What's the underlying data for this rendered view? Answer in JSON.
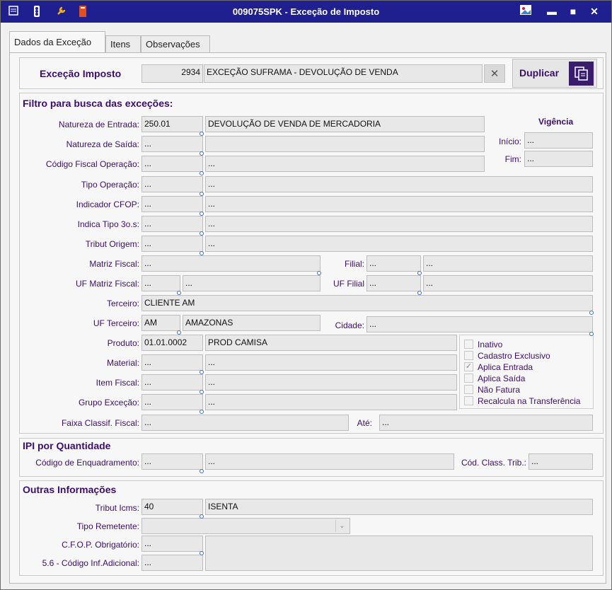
{
  "window": {
    "title": "009075SPK - Exceção de Imposto",
    "titlebar_color": "#1f1f8f",
    "toolbar_icons": [
      "menu-icon",
      "traffic-light-icon",
      "wrench-icon",
      "book-icon"
    ],
    "controls": [
      "image-icon",
      "minimize-icon",
      "maximize-icon",
      "close-icon"
    ]
  },
  "tabs": [
    "Dados da Exceção",
    "Itens",
    "Observações"
  ],
  "header": {
    "label": "Exceção Imposto",
    "code": "2934",
    "description": "EXCEÇÃO SUFRAMA - DEVOLUÇÃO DE VENDA",
    "clear_icon": "✕",
    "duplicate_label": "Duplicar"
  },
  "filter": {
    "title": "Filtro para busca das exceções:",
    "vigencia_title": "Vigência",
    "vigencia_inicio_label": "Início:",
    "vigencia_inicio": "...",
    "vigencia_fim_label": "Fim:",
    "vigencia_fim": "...",
    "natureza_entrada_label": "Natureza de Entrada:",
    "natureza_entrada_code": "250.01",
    "natureza_entrada_desc": "DEVOLUÇÃO DE VENDA DE MERCADORIA",
    "natureza_saida_label": "Natureza de Saída:",
    "natureza_saida_code": "...",
    "natureza_saida_desc": "",
    "cfo_label": "Código Fiscal Operação:",
    "cfo_code": "...",
    "cfo_desc": "...",
    "tipo_operacao_label": "Tipo Operação:",
    "tipo_operacao_code": "...",
    "tipo_operacao_desc": "...",
    "indicador_cfop_label": "Indicador CFOP:",
    "indicador_cfop_code": "...",
    "indicador_cfop_desc": "...",
    "indica_tipo_label": "Indica Tipo 3o.s:",
    "indica_tipo_code": "...",
    "indica_tipo_desc": "...",
    "tribut_origem_label": "Tribut Origem:",
    "tribut_origem_code": "...",
    "tribut_origem_desc": "...",
    "matriz_fiscal_label": "Matriz Fiscal:",
    "matriz_fiscal_value": "...",
    "filial_label": "Filial:",
    "filial_code": "...",
    "filial_desc": "...",
    "uf_matriz_label": "UF Matriz Fiscal:",
    "uf_matriz_code": "...",
    "uf_matriz_desc": "...",
    "uf_filial_label": "UF Filial",
    "uf_filial_code": "...",
    "uf_filial_desc": "...",
    "terceiro_label": "Terceiro:",
    "terceiro_value": "CLIENTE AM",
    "uf_terceiro_label": "UF Terceiro:",
    "uf_terceiro_code": "AM",
    "uf_terceiro_desc": "AMAZONAS",
    "cidade_label": "Cidade:",
    "cidade_value": "...",
    "produto_label": "Produto:",
    "produto_code": "01.01.0002",
    "produto_desc": "PROD CAMISA",
    "material_label": "Material:",
    "material_code": "...",
    "material_desc": "...",
    "item_fiscal_label": "Item Fiscal:",
    "item_fiscal_code": "...",
    "item_fiscal_desc": "...",
    "grupo_excecao_label": "Grupo Exceção:",
    "grupo_excecao_code": "...",
    "grupo_excecao_desc": "...",
    "faixa_label": "Faixa Classif. Fiscal:",
    "faixa_de": "...",
    "ate_label": "Até:",
    "faixa_ate": "...",
    "checkboxes": [
      {
        "label": "Inativo",
        "checked": false
      },
      {
        "label": "Cadastro Exclusivo",
        "checked": false
      },
      {
        "label": "Aplica Entrada",
        "checked": true
      },
      {
        "label": "Aplica Saída",
        "checked": false
      },
      {
        "label": "Não Fatura",
        "checked": false
      },
      {
        "label": "Recalcula na Transferência",
        "checked": false
      }
    ]
  },
  "ipi": {
    "title": "IPI por Quantidade",
    "enquadramento_label": "Código de Enquadramento:",
    "enquadramento_code": "...",
    "enquadramento_desc": "...",
    "class_trib_label": "Cód. Class. Trib.:",
    "class_trib_value": "..."
  },
  "outras": {
    "title": "Outras Informações",
    "tribut_icms_label": "Tribut Icms:",
    "tribut_icms_code": "40",
    "tribut_icms_desc": "ISENTA",
    "tipo_remetente_label": "Tipo Remetente:",
    "tipo_remetente_value": "",
    "cfop_obrig_label": "C.F.O.P. Obrigatório:",
    "cfop_obrig_code": "...",
    "cfop_obrig_desc": "",
    "inf_adicional_label": "5.6 - Código Inf.Adicional:",
    "inf_adicional_value": "..."
  },
  "colors": {
    "label": "#3b0e6e",
    "accent": "#3a1c6e"
  }
}
